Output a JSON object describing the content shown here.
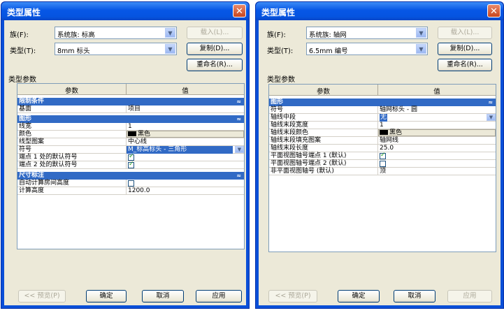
{
  "left": {
    "title": "类型属性",
    "family_label": "族(F):",
    "family_value": "系统族: 标高",
    "type_label": "类型(T):",
    "type_value": "8mm 标头",
    "load_button": "载入(L)...",
    "duplicate_button": "复制(D)...",
    "rename_button": "重命名(R)...",
    "group_label": "类型参数",
    "col_param": "参数",
    "col_value": "值",
    "sections": [
      {
        "name": "限制条件",
        "rows": [
          {
            "name": "基面",
            "value": "项目"
          }
        ]
      },
      {
        "name": "图形",
        "rows": [
          {
            "name": "线宽",
            "value": "1"
          },
          {
            "name": "颜色",
            "value": "黑色"
          },
          {
            "name": "线型图案",
            "value": "中心线"
          },
          {
            "name": "符号",
            "value": "M_标高标头 - 三角形"
          },
          {
            "name": "端点 1 处的默认符号",
            "value": ""
          },
          {
            "name": "端点 2 处的默认符号",
            "value": ""
          }
        ]
      },
      {
        "name": "尺寸标注",
        "rows": [
          {
            "name": "自动计算房间高度",
            "value": ""
          },
          {
            "name": "计算高度",
            "value": "1200.0"
          }
        ]
      }
    ],
    "preview_button": "<< 预览(P)",
    "ok_button": "确定",
    "cancel_button": "取消",
    "apply_button": "应用"
  },
  "right": {
    "title": "类型属性",
    "family_label": "族(F):",
    "family_value": "系统族: 轴网",
    "type_label": "类型(T):",
    "type_value": "6.5mm 编号",
    "load_button": "载入(L)...",
    "duplicate_button": "复制(D)...",
    "rename_button": "重命名(R)...",
    "group_label": "类型参数",
    "col_param": "参数",
    "col_value": "值",
    "sections": [
      {
        "name": "图形",
        "rows": [
          {
            "name": "符号",
            "value": "轴网标头 - 圆"
          },
          {
            "name": "轴线中段",
            "value": "无"
          },
          {
            "name": "轴线末段宽度",
            "value": "1"
          },
          {
            "name": "轴线末段颜色",
            "value": "黑色"
          },
          {
            "name": "轴线末段填充图案",
            "value": "轴网线"
          },
          {
            "name": "轴线末段长度",
            "value": "25.0"
          },
          {
            "name": "平面视图轴号端点 1 (默认)",
            "value": ""
          },
          {
            "name": "平面视图轴号端点 2 (默认)",
            "value": ""
          },
          {
            "name": "非平面视图轴号 (默认)",
            "value": "顶"
          }
        ]
      }
    ],
    "preview_button": "<< 预览(P)",
    "ok_button": "确定",
    "cancel_button": "取消",
    "apply_button": "应用"
  },
  "icons": {
    "close": "close-icon",
    "dropdown": "chevron-down-icon",
    "collapse": "double-chevron-up-icon",
    "checkbox": "checkbox-icon"
  },
  "colors": {
    "title_bar": "#0a4fd8",
    "category": "#316ac5",
    "dialog_bg": "#ece9d8",
    "check": "#21a121"
  },
  "checkboxes": {
    "left_endpoint1": true,
    "left_endpoint2": true,
    "left_auto_room": false,
    "right_plan1": true,
    "right_plan2": false
  }
}
